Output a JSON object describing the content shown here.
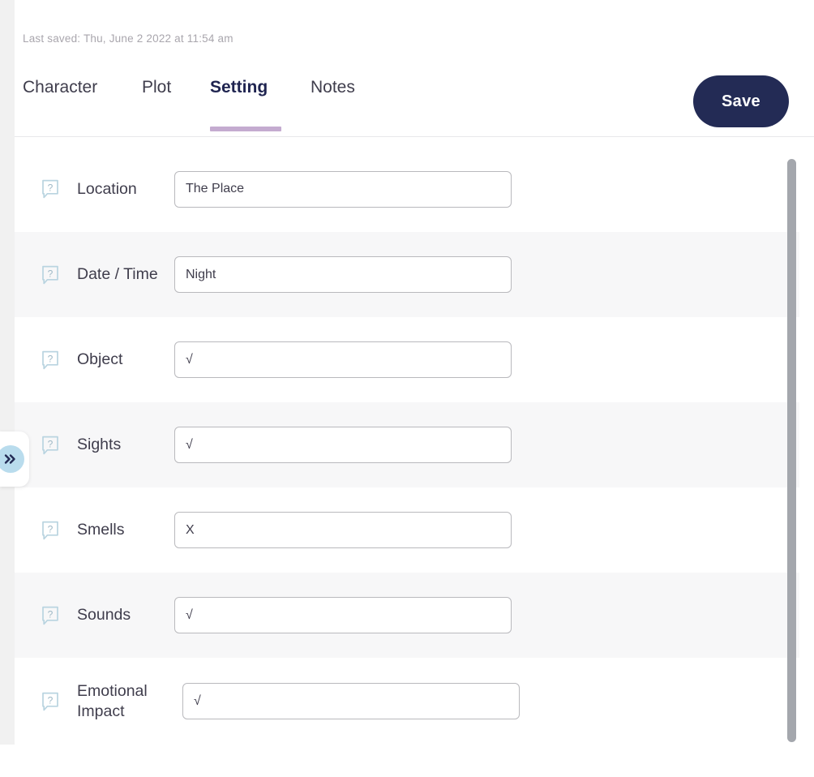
{
  "header": {
    "last_saved": "Last saved: Thu, June 2 2022 at 11:54 am",
    "save_label": "Save"
  },
  "tabs": [
    {
      "label": "Character",
      "active": false
    },
    {
      "label": "Plot",
      "active": false
    },
    {
      "label": "Setting",
      "active": true
    },
    {
      "label": "Notes",
      "active": false
    }
  ],
  "form": {
    "help_icon": "help-question-bubble-icon",
    "rows": [
      {
        "label": "Location",
        "value": "The Place",
        "placeholder": ""
      },
      {
        "label": "Date / Time",
        "value": "Night",
        "placeholder": ""
      },
      {
        "label": "Object",
        "value": "√",
        "placeholder": ""
      },
      {
        "label": "Sights",
        "value": "√",
        "placeholder": ""
      },
      {
        "label": "Smells",
        "value": "X",
        "placeholder": ""
      },
      {
        "label": "Sounds",
        "value": "√",
        "placeholder": ""
      },
      {
        "label": "Emotional Impact",
        "value": "√",
        "placeholder": ""
      }
    ]
  },
  "sidebar_handle": {
    "icon": "double-chevron-right-icon"
  },
  "colors": {
    "accent_underline": "#c4abd0",
    "save_button": "#232b55",
    "active_tab_text": "#1f2450",
    "help_icon": "#b9d4e0",
    "handle_bg": "#b9dced",
    "row_alt_bg": "#f7f7f8",
    "scrollbar_thumb": "#a4a7ad"
  }
}
